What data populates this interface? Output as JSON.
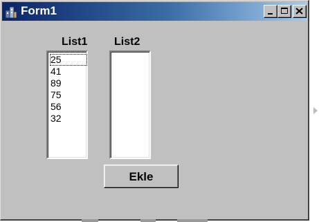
{
  "window": {
    "title": "Form1",
    "icon": "form-app-icon",
    "caption_buttons": [
      "minimize-icon",
      "maximize-icon",
      "close-icon"
    ]
  },
  "labels": {
    "list1": "List1",
    "list2": "List2"
  },
  "list1": {
    "items": [
      "25",
      "41",
      "89",
      "75",
      "56",
      "32"
    ],
    "focused_index": 0
  },
  "list2": {
    "items": []
  },
  "button": {
    "label": "Ekle"
  },
  "colors": {
    "face": "#c0c0c0",
    "title_active_start": "#0a246a",
    "title_active_end": "#a6caf0",
    "title_text": "#ffffff"
  }
}
